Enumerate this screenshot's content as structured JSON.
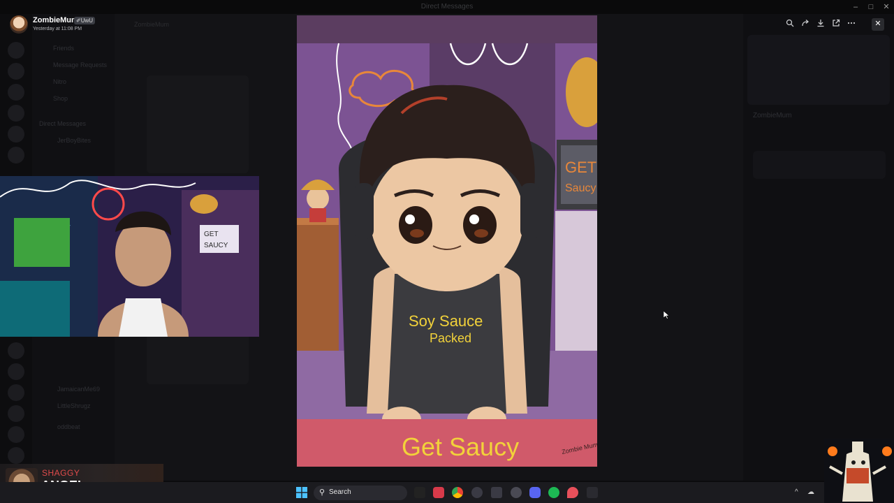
{
  "window": {
    "title": "Direct Messages",
    "controls": {
      "minimize": "–",
      "maximize": "□",
      "close": "✕"
    }
  },
  "user_header": {
    "name": "ZombieMum",
    "badge": "✐UwU",
    "timestamp": "Yesterday at 11:08 PM"
  },
  "background": {
    "sidebar_items": [
      "Friends",
      "Message Requests",
      "Nitro",
      "Shop"
    ],
    "section_label": "Direct Messages",
    "chat_channel": "ZombieMum",
    "member_name": "ZombieMum",
    "dm_names": [
      "JerBoyBites",
      "LittleShrugz",
      "JamaicanMe69",
      "oddbeat"
    ]
  },
  "viewer_toolbar": {
    "icons": [
      "zoom-icon",
      "forward-icon",
      "download-icon",
      "open-external-icon",
      "more-icon"
    ],
    "close": "✕"
  },
  "artwork": {
    "shirt_text_line1": "Soy Sauce",
    "shirt_text_line2": "Packed",
    "banner_text": "Get Saucy",
    "monitor_text_line1": "GET",
    "monitor_text_line2": "Saucy",
    "signature": "Zombie Mum"
  },
  "webcam": {
    "sign_line1": "GET",
    "sign_line2": "SAUCY"
  },
  "sub_overlay": {
    "line1": "SHAGGY",
    "line2": "ANGEL"
  },
  "taskbar": {
    "search_placeholder": "Search",
    "tray_chevron": "^"
  },
  "colors": {
    "accent_red": "#e14b4b",
    "art_purple": "#6e4b7a",
    "art_pink": "#d05a6a",
    "signature_yellow": "#f2d23a"
  }
}
